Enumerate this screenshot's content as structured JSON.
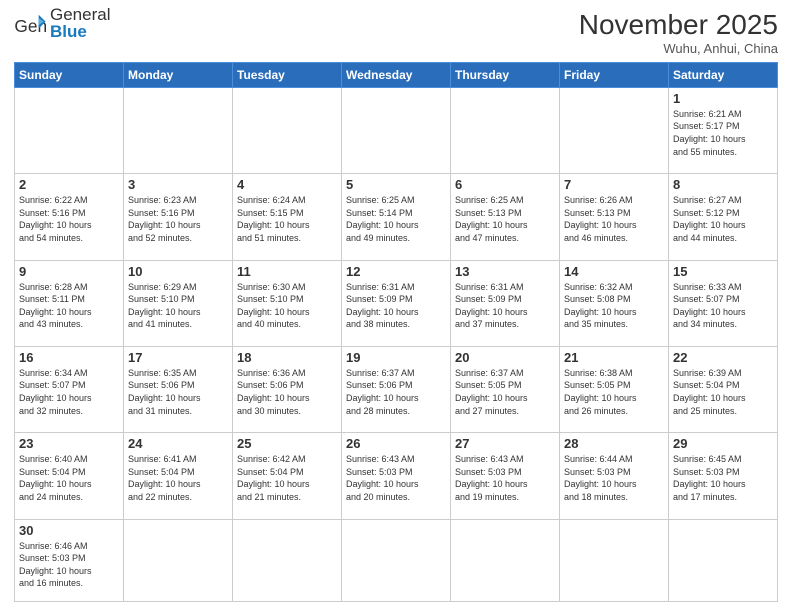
{
  "logo": {
    "text_general": "General",
    "text_blue": "Blue"
  },
  "title": "November 2025",
  "subtitle": "Wuhu, Anhui, China",
  "days_of_week": [
    "Sunday",
    "Monday",
    "Tuesday",
    "Wednesday",
    "Thursday",
    "Friday",
    "Saturday"
  ],
  "weeks": [
    [
      {
        "day": "",
        "info": ""
      },
      {
        "day": "",
        "info": ""
      },
      {
        "day": "",
        "info": ""
      },
      {
        "day": "",
        "info": ""
      },
      {
        "day": "",
        "info": ""
      },
      {
        "day": "",
        "info": ""
      },
      {
        "day": "1",
        "info": "Sunrise: 6:21 AM\nSunset: 5:17 PM\nDaylight: 10 hours\nand 55 minutes."
      }
    ],
    [
      {
        "day": "2",
        "info": "Sunrise: 6:22 AM\nSunset: 5:16 PM\nDaylight: 10 hours\nand 54 minutes."
      },
      {
        "day": "3",
        "info": "Sunrise: 6:23 AM\nSunset: 5:16 PM\nDaylight: 10 hours\nand 52 minutes."
      },
      {
        "day": "4",
        "info": "Sunrise: 6:24 AM\nSunset: 5:15 PM\nDaylight: 10 hours\nand 51 minutes."
      },
      {
        "day": "5",
        "info": "Sunrise: 6:25 AM\nSunset: 5:14 PM\nDaylight: 10 hours\nand 49 minutes."
      },
      {
        "day": "6",
        "info": "Sunrise: 6:25 AM\nSunset: 5:13 PM\nDaylight: 10 hours\nand 47 minutes."
      },
      {
        "day": "7",
        "info": "Sunrise: 6:26 AM\nSunset: 5:13 PM\nDaylight: 10 hours\nand 46 minutes."
      },
      {
        "day": "8",
        "info": "Sunrise: 6:27 AM\nSunset: 5:12 PM\nDaylight: 10 hours\nand 44 minutes."
      }
    ],
    [
      {
        "day": "9",
        "info": "Sunrise: 6:28 AM\nSunset: 5:11 PM\nDaylight: 10 hours\nand 43 minutes."
      },
      {
        "day": "10",
        "info": "Sunrise: 6:29 AM\nSunset: 5:10 PM\nDaylight: 10 hours\nand 41 minutes."
      },
      {
        "day": "11",
        "info": "Sunrise: 6:30 AM\nSunset: 5:10 PM\nDaylight: 10 hours\nand 40 minutes."
      },
      {
        "day": "12",
        "info": "Sunrise: 6:31 AM\nSunset: 5:09 PM\nDaylight: 10 hours\nand 38 minutes."
      },
      {
        "day": "13",
        "info": "Sunrise: 6:31 AM\nSunset: 5:09 PM\nDaylight: 10 hours\nand 37 minutes."
      },
      {
        "day": "14",
        "info": "Sunrise: 6:32 AM\nSunset: 5:08 PM\nDaylight: 10 hours\nand 35 minutes."
      },
      {
        "day": "15",
        "info": "Sunrise: 6:33 AM\nSunset: 5:07 PM\nDaylight: 10 hours\nand 34 minutes."
      }
    ],
    [
      {
        "day": "16",
        "info": "Sunrise: 6:34 AM\nSunset: 5:07 PM\nDaylight: 10 hours\nand 32 minutes."
      },
      {
        "day": "17",
        "info": "Sunrise: 6:35 AM\nSunset: 5:06 PM\nDaylight: 10 hours\nand 31 minutes."
      },
      {
        "day": "18",
        "info": "Sunrise: 6:36 AM\nSunset: 5:06 PM\nDaylight: 10 hours\nand 30 minutes."
      },
      {
        "day": "19",
        "info": "Sunrise: 6:37 AM\nSunset: 5:06 PM\nDaylight: 10 hours\nand 28 minutes."
      },
      {
        "day": "20",
        "info": "Sunrise: 6:37 AM\nSunset: 5:05 PM\nDaylight: 10 hours\nand 27 minutes."
      },
      {
        "day": "21",
        "info": "Sunrise: 6:38 AM\nSunset: 5:05 PM\nDaylight: 10 hours\nand 26 minutes."
      },
      {
        "day": "22",
        "info": "Sunrise: 6:39 AM\nSunset: 5:04 PM\nDaylight: 10 hours\nand 25 minutes."
      }
    ],
    [
      {
        "day": "23",
        "info": "Sunrise: 6:40 AM\nSunset: 5:04 PM\nDaylight: 10 hours\nand 24 minutes."
      },
      {
        "day": "24",
        "info": "Sunrise: 6:41 AM\nSunset: 5:04 PM\nDaylight: 10 hours\nand 22 minutes."
      },
      {
        "day": "25",
        "info": "Sunrise: 6:42 AM\nSunset: 5:04 PM\nDaylight: 10 hours\nand 21 minutes."
      },
      {
        "day": "26",
        "info": "Sunrise: 6:43 AM\nSunset: 5:03 PM\nDaylight: 10 hours\nand 20 minutes."
      },
      {
        "day": "27",
        "info": "Sunrise: 6:43 AM\nSunset: 5:03 PM\nDaylight: 10 hours\nand 19 minutes."
      },
      {
        "day": "28",
        "info": "Sunrise: 6:44 AM\nSunset: 5:03 PM\nDaylight: 10 hours\nand 18 minutes."
      },
      {
        "day": "29",
        "info": "Sunrise: 6:45 AM\nSunset: 5:03 PM\nDaylight: 10 hours\nand 17 minutes."
      }
    ],
    [
      {
        "day": "30",
        "info": "Sunrise: 6:46 AM\nSunset: 5:03 PM\nDaylight: 10 hours\nand 16 minutes."
      },
      {
        "day": "",
        "info": ""
      },
      {
        "day": "",
        "info": ""
      },
      {
        "day": "",
        "info": ""
      },
      {
        "day": "",
        "info": ""
      },
      {
        "day": "",
        "info": ""
      },
      {
        "day": "",
        "info": ""
      }
    ]
  ]
}
